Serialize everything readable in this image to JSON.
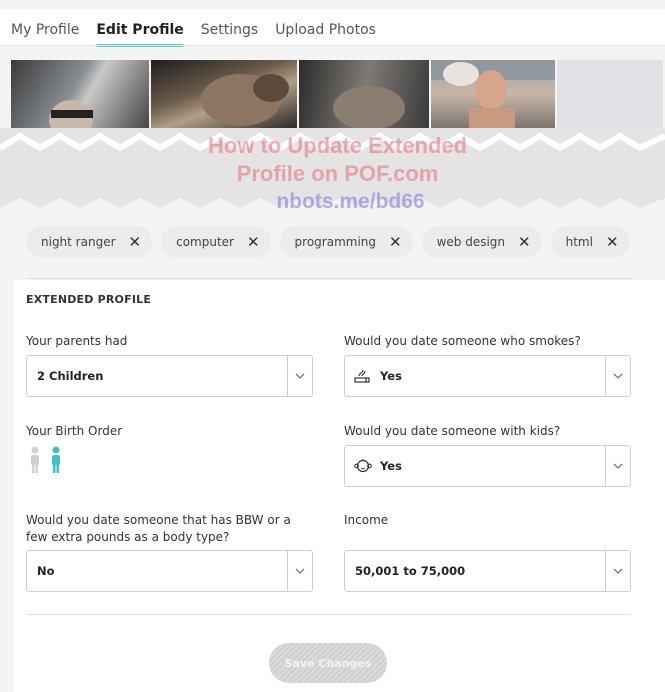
{
  "tabs": [
    "My Profile",
    "Edit Profile",
    "Settings",
    "Upload Photos"
  ],
  "active_tab": "Edit Profile",
  "watermark": {
    "line1": "How to Update Extended",
    "line2": "Profile on POF.com",
    "line3": "nbots.me/bd66"
  },
  "tags": [
    "night ranger",
    "computer",
    "programming",
    "web design",
    "html"
  ],
  "section_title": "EXTENDED PROFILE",
  "fields": {
    "parents": {
      "label": "Your parents had",
      "value": "2 Children"
    },
    "smokes": {
      "label": "Would you date someone who smokes?",
      "value": "Yes",
      "icon": "smoking-icon"
    },
    "birth_order": {
      "label": "Your Birth Order"
    },
    "kids": {
      "label": "Would you date someone with kids?",
      "value": "Yes",
      "icon": "baby-icon"
    },
    "bbw": {
      "label_line1": "Would you date someone that has BBW or a",
      "label_line2": "few extra pounds as a body type?",
      "value": "No"
    },
    "income": {
      "label": "Income",
      "value": "50,001 to 75,000"
    }
  },
  "save_label": "Save Changes",
  "colors": {
    "accent": "#5fd5cf",
    "person_active": "#3fbfc4",
    "person_inactive": "#d0d0d0"
  }
}
